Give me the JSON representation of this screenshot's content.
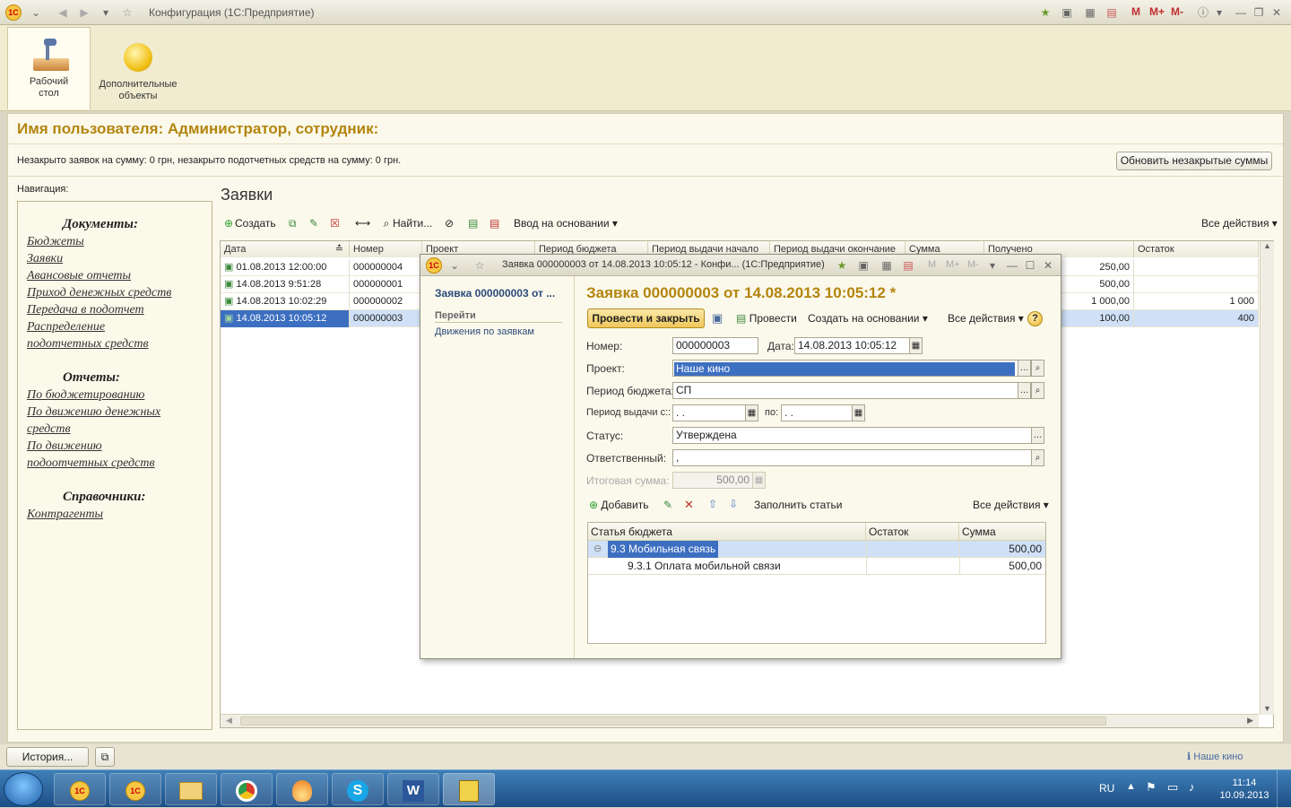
{
  "window": {
    "title": "Конфигурация  (1С:Предприятие)",
    "m_buttons": [
      "M",
      "M+",
      "M-"
    ]
  },
  "sections": [
    {
      "label": "Рабочий стол"
    },
    {
      "label": "Дополнительные объекты"
    }
  ],
  "header": {
    "user_line": "Имя пользователя: Администратор, сотрудник:"
  },
  "info": {
    "text": "Незакрыто заявок на сумму: 0 грн, незакрыто подотчетных средств на сумму: 0 грн.",
    "refresh_button": "Обновить незакрытые суммы"
  },
  "navigation": {
    "label": "Навигация:",
    "groups": [
      {
        "title": "Документы:",
        "items": [
          "Бюджеты",
          "Заявки",
          "Авансовые отчеты",
          "Приход денежных средств",
          "Передача в подотчет",
          "Распределение",
          "подотчетных средств"
        ]
      },
      {
        "title": "Отчеты:",
        "items": [
          "По бюджетированию",
          "По движению денежных",
          "средств",
          "По движению",
          "подоотчетных средств"
        ]
      },
      {
        "title": "Справочники:",
        "items": [
          "Контрагенты"
        ]
      }
    ]
  },
  "list": {
    "title": "Заявки",
    "toolbar": {
      "create": "Создать",
      "find": "Найти...",
      "input_based": "Ввод на основании",
      "all_actions": "Все действия"
    },
    "columns": [
      "Дата",
      "Номер",
      "Проект",
      "Период бюджета",
      "Период выдачи начало",
      "Период выдачи окончание",
      "Сумма",
      "Получено",
      "Остаток"
    ],
    "rows": [
      {
        "date": "01.08.2013 12:00:00",
        "number": "000000004",
        "received": "250,00",
        "rest": ""
      },
      {
        "date": "14.08.2013 9:51:28",
        "number": "000000001",
        "received": "500,00",
        "rest": ""
      },
      {
        "date": "14.08.2013 10:02:29",
        "number": "000000002",
        "received": "1 000,00",
        "rest": "1 000"
      },
      {
        "date": "14.08.2013 10:05:12",
        "number": "000000003",
        "received": "100,00",
        "rest": "400"
      }
    ]
  },
  "dialog": {
    "titlebar": "Заявка 000000003 от 14.08.2013 10:05:12 - Конфи...  (1С:Предприятие)",
    "m_buttons": [
      "M",
      "M+",
      "M-"
    ],
    "left_title": "Заявка 000000003 от ...",
    "goto_label": "Перейти",
    "goto_link": "Движения по заявкам",
    "heading": "Заявка 000000003 от 14.08.2013 10:05:12 *",
    "toolbar": {
      "post_close": "Провести и закрыть",
      "post": "Провести",
      "create_based": "Создать на основании",
      "all_actions": "Все действия",
      "help": "?"
    },
    "fields": {
      "number_label": "Номер:",
      "number": "000000003",
      "date_label": "Дата:",
      "date": "14.08.2013 10:05:12",
      "project_label": "Проект:",
      "project": "Наше кино",
      "budget_period_label": "Период бюджета:",
      "budget_period": "СП",
      "issue_period_label": "Период выдачи с::",
      "issue_from": " .  .",
      "to_label": "по:",
      "issue_to": " .  .",
      "status_label": "Статус:",
      "status": "Утверждена",
      "responsible_label": "Ответственный:",
      "responsible": ",",
      "total_label": "Итоговая сумма:",
      "total": "500,00"
    },
    "grid_toolbar": {
      "add": "Добавить",
      "fill": "Заполнить статьи",
      "all_actions": "Все действия"
    },
    "grid": {
      "columns": [
        "Статья бюджета",
        "Остаток",
        "Сумма"
      ],
      "rows": [
        {
          "name": "9.3 Мобильная связь",
          "rest": "",
          "sum": "500,00"
        },
        {
          "name": "9.3.1 Оплата мобильной связи",
          "rest": "",
          "sum": "500,00"
        }
      ]
    }
  },
  "statusbar": {
    "history": "История...",
    "right": "Наше кино"
  },
  "taskbar": {
    "lang": "RU",
    "time": "11:14",
    "date": "10.09.2013"
  }
}
